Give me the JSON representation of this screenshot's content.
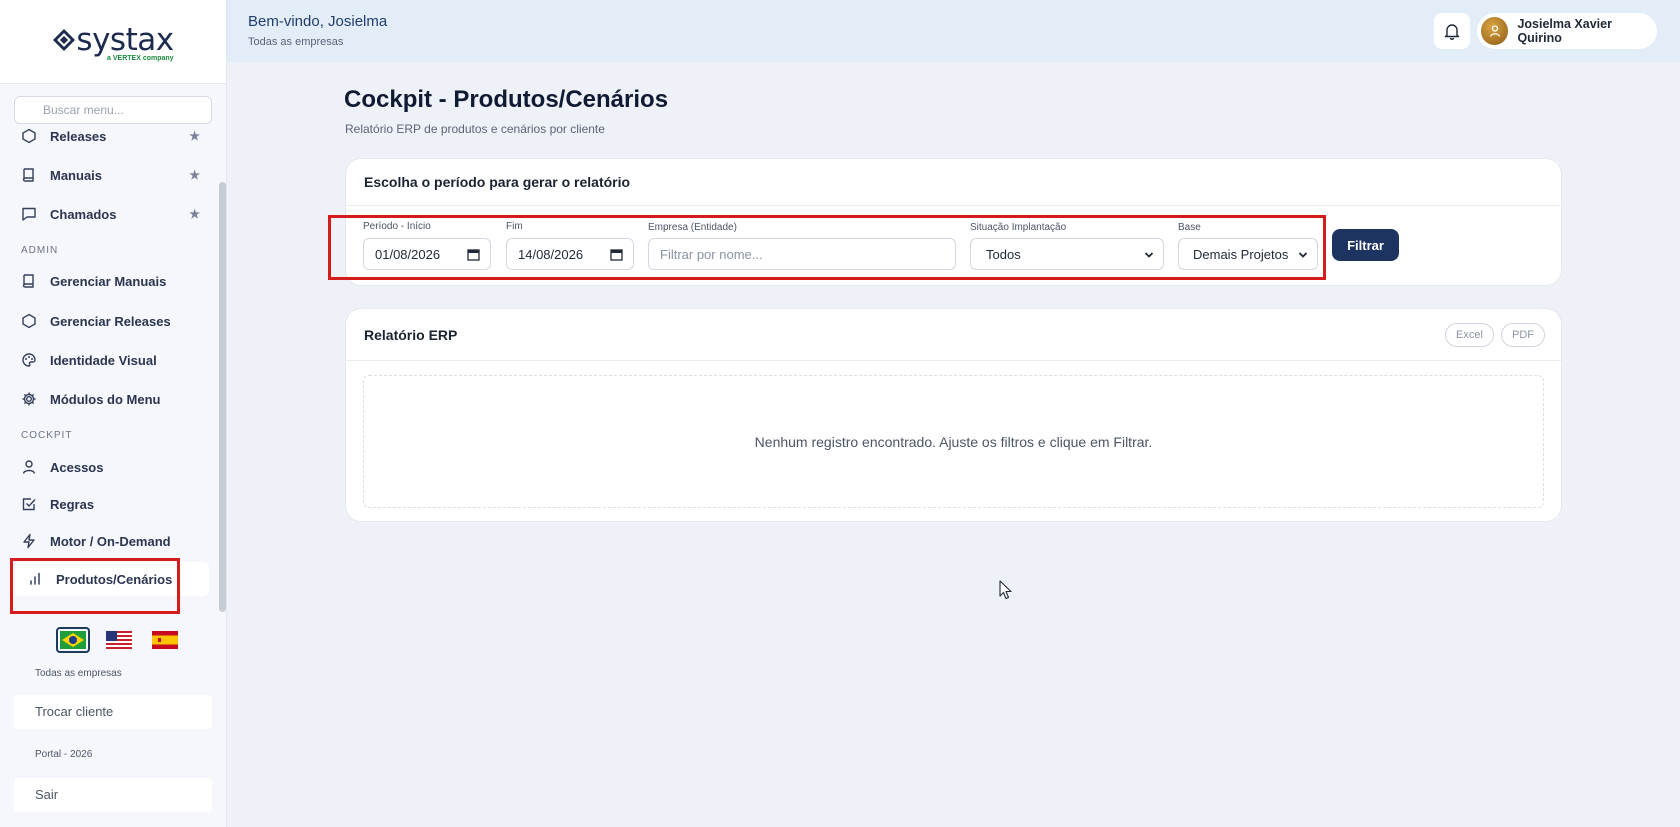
{
  "brand": {
    "name": "systax",
    "tagline": "a VERTEX company"
  },
  "sidebar": {
    "search_placeholder": "Buscar menu...",
    "items_top": [
      {
        "label": "Releases",
        "icon": "hexagon-icon",
        "starred": true
      },
      {
        "label": "Manuais",
        "icon": "book-icon",
        "starred": true
      },
      {
        "label": "Chamados",
        "icon": "chat-icon",
        "starred": true
      }
    ],
    "section_admin": "ADMIN",
    "items_admin": [
      {
        "label": "Gerenciar Manuais",
        "icon": "book-icon"
      },
      {
        "label": "Gerenciar Releases",
        "icon": "hexagon-icon"
      },
      {
        "label": "Identidade Visual",
        "icon": "palette-icon"
      },
      {
        "label": "Módulos do Menu",
        "icon": "gear-icon"
      }
    ],
    "section_cockpit": "COCKPIT",
    "items_cockpit": [
      {
        "label": "Acessos",
        "icon": "user-icon"
      },
      {
        "label": "Regras",
        "icon": "checkbox-icon"
      },
      {
        "label": "Motor / On-Demand",
        "icon": "lightning-icon"
      },
      {
        "label": "Produtos/Cenários",
        "icon": "bar-chart-icon",
        "active": true
      }
    ],
    "scope_label": "Todas as empresas",
    "switch_client": "Trocar cliente",
    "portal_version": "Portal - 2026",
    "logout": "Sair"
  },
  "header": {
    "welcome": "Bem-vindo, Josielma",
    "scope": "Todas as empresas",
    "user_name": "Josielma Xavier Quirino"
  },
  "page": {
    "title": "Cockpit - Produtos/Cenários",
    "subtitle": "Relatório ERP de produtos e cenários por cliente"
  },
  "filters": {
    "card_title": "Escolha o período para gerar o relatório",
    "start_label": "Período - Início",
    "start_value": "01/08/2026",
    "end_label": "Fim",
    "end_value": "14/08/2026",
    "company_label": "Empresa (Entidade)",
    "company_placeholder": "Filtrar por nome...",
    "status_label": "Situação Implantação",
    "status_value": "Todos",
    "base_label": "Base",
    "base_value": "Demais Projetos",
    "submit": "Filtrar"
  },
  "report": {
    "title": "Relatório ERP",
    "excel": "Excel",
    "pdf": "PDF",
    "empty_message": "Nenhum registro encontrado. Ajuste os filtros e clique em Filtrar."
  },
  "colors": {
    "primary": "#1d3461",
    "highlight": "#d41c1c",
    "sidebar_bg": "#f5f7fc",
    "topbar_bg": "#e3edf8"
  }
}
